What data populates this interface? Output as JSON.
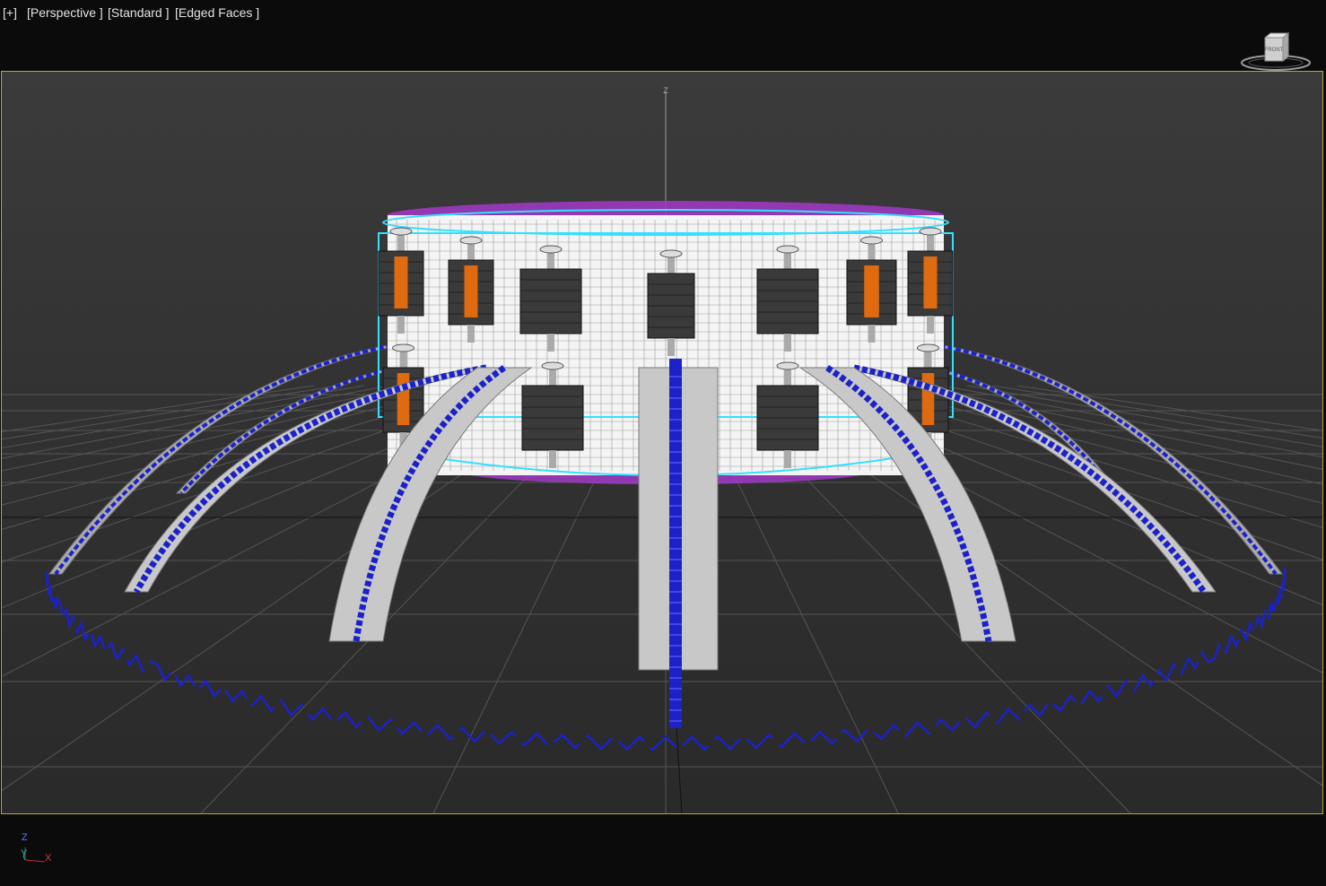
{
  "viewport": {
    "labels": {
      "plus": "[+]",
      "view": "[Perspective ]",
      "shading": "[Standard ]",
      "edges": "[Edged Faces ]"
    },
    "viewcube": {
      "face_label": "FRONT"
    },
    "grid_axis_label": "Z",
    "active_border_color": "#b5a640"
  },
  "axis_tripod": {
    "z": "Z",
    "y": "Y",
    "x": "X"
  },
  "colors": {
    "background": "#0b0b0b",
    "viewport_bg": "#363636",
    "grid": "#8a8a8a",
    "mesh_white": "#f2f2f2",
    "selection_cyan": "#33e0ff",
    "blue_spline": "#1c22c8",
    "purple_ring": "#a23ac8",
    "orange_panel": "#e06a10"
  },
  "icons": [
    "viewcube-icon",
    "axis-tripod-icon"
  ]
}
